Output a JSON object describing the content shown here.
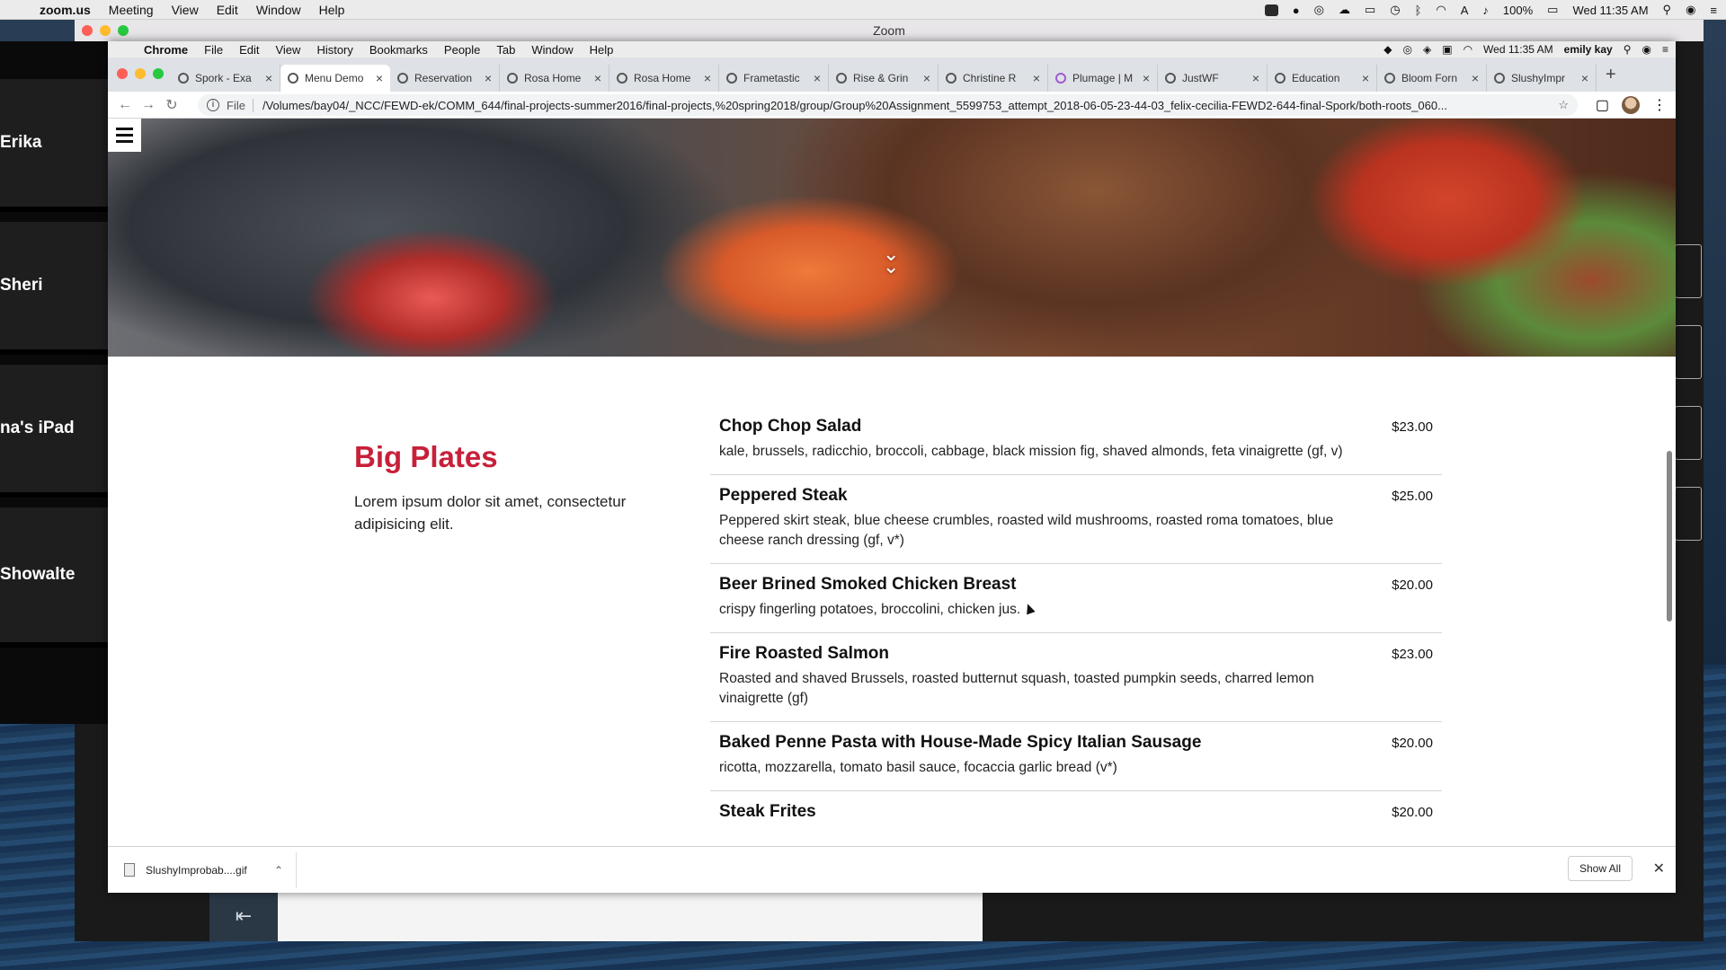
{
  "macbar": {
    "app": "zoom.us",
    "menus": [
      "Meeting",
      "View",
      "Edit",
      "Window",
      "Help"
    ],
    "battery": "100%",
    "clock": "Wed 11:35 AM"
  },
  "zoom": {
    "title": "Zoom",
    "participants": [
      "Erika",
      "Sheri",
      "na's iPad",
      "Showalte"
    ],
    "back_icon": "⇤"
  },
  "chrome": {
    "app": "Chrome",
    "menus": [
      "File",
      "Edit",
      "View",
      "History",
      "Bookmarks",
      "People",
      "Tab",
      "Window",
      "Help"
    ],
    "clock": "Wed 11:35 AM",
    "user": "emily kay",
    "tabs": [
      {
        "title": "Spork - Exa"
      },
      {
        "title": "Menu Demo"
      },
      {
        "title": "Reservation"
      },
      {
        "title": "Rosa Home"
      },
      {
        "title": "Rosa Home"
      },
      {
        "title": "Frametastic"
      },
      {
        "title": "Rise & Grin"
      },
      {
        "title": "Christine R"
      },
      {
        "title": "Plumage | M"
      },
      {
        "title": "JustWF"
      },
      {
        "title": "Education"
      },
      {
        "title": "Bloom Forn"
      },
      {
        "title": "SlushyImpr"
      }
    ],
    "active_tab": 1,
    "address": {
      "label": "File",
      "url": "/Volumes/bay04/_NCC/FEWD-ek/COMM_644/final-projects-summer2016/final-projects,%20spring2018/group/Group%20Assignment_5599753_attempt_2018-06-05-23-44-03_felix-cecilia-FEWD2-644-final-Spork/both-roots_060..."
    }
  },
  "page": {
    "section_title": "Big Plates",
    "section_desc": "Lorem ipsum dolor sit amet, consectetur adipisicing elit.",
    "items": [
      {
        "name": "Chop Chop Salad",
        "desc": "kale, brussels, radicchio, broccoli, cabbage, black mission fig, shaved almonds, feta vinaigrette (gf, v)",
        "price": "$23.00"
      },
      {
        "name": "Peppered Steak",
        "desc": "Peppered skirt steak, blue cheese crumbles, roasted wild mushrooms, roasted roma tomatoes, blue cheese ranch dressing (gf, v*)",
        "price": "$25.00"
      },
      {
        "name": "Beer Brined Smoked Chicken Breast",
        "desc": "crispy fingerling potatoes, broccolini, chicken jus.",
        "price": "$20.00"
      },
      {
        "name": "Fire Roasted Salmon",
        "desc": "Roasted and shaved Brussels, roasted butternut squash, toasted pumpkin seeds, charred lemon vinaigrette (gf)",
        "price": "$23.00"
      },
      {
        "name": "Baked Penne Pasta with House-Made Spicy Italian Sausage",
        "desc": "ricotta, mozzarella, tomato basil sauce, focaccia garlic bread (v*)",
        "price": "$20.00"
      },
      {
        "name": "Steak Frites",
        "desc": "",
        "price": "$20.00"
      }
    ]
  },
  "shelf": {
    "file": "SlushyImprobab....gif",
    "show_all": "Show All"
  }
}
